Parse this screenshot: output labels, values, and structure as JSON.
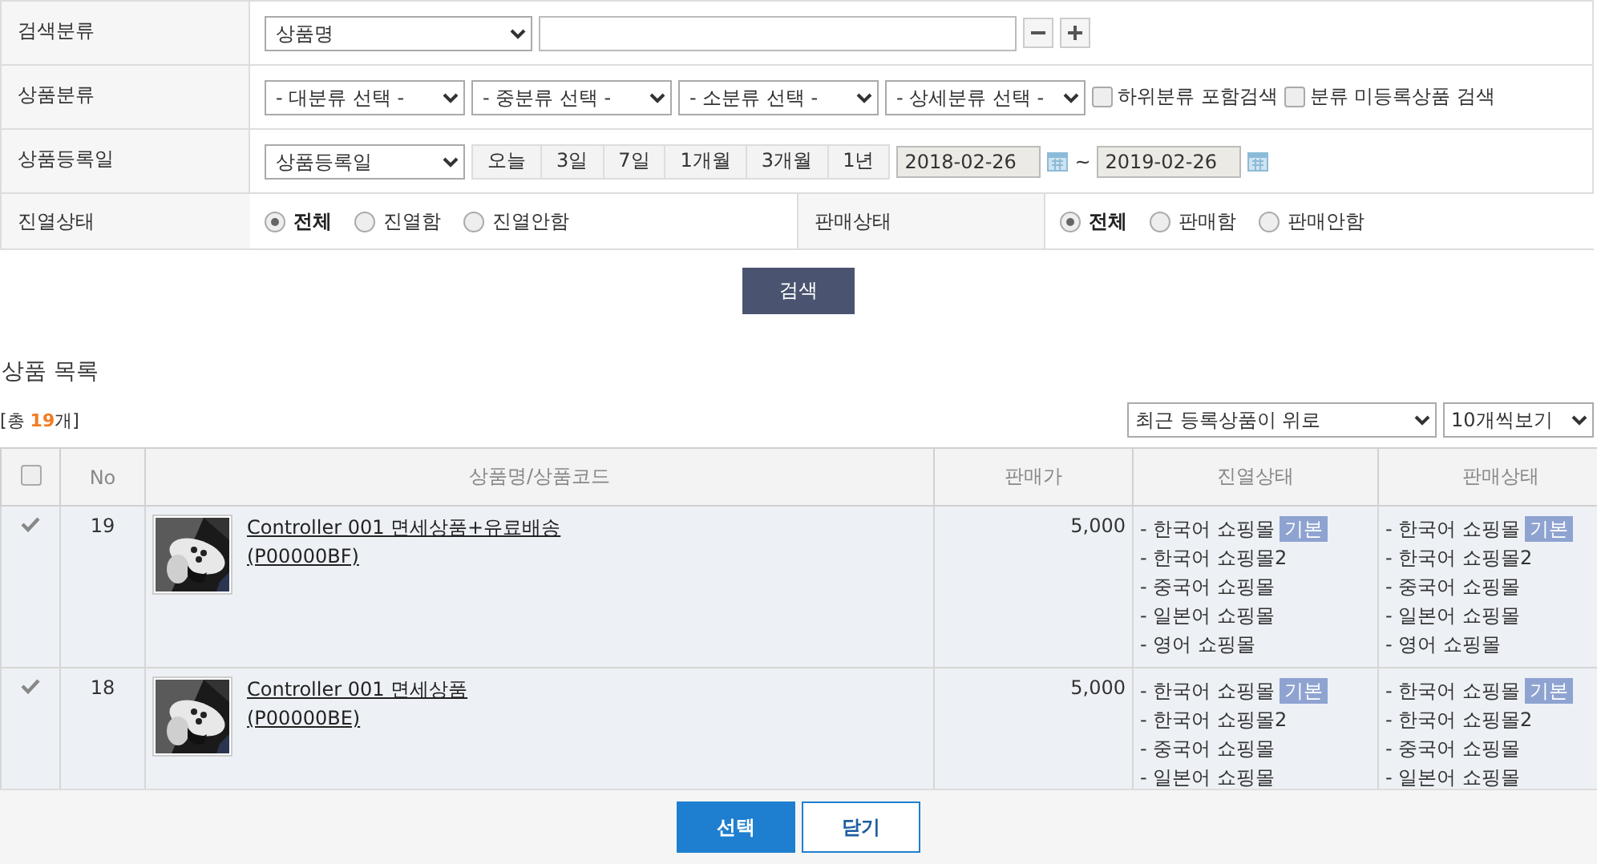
{
  "search_form": {
    "rows": [
      {
        "kind": "keyword",
        "label": "검색분류",
        "select": "상품명"
      },
      {
        "kind": "category",
        "label": "상품분류",
        "selects": [
          "- 대분류 선택 -",
          "- 중분류 선택 -",
          "- 소분류 선택 -",
          "- 상세분류 선택 -"
        ],
        "checkboxes": [
          {
            "label": "하위분류 포함검색",
            "checked": false
          },
          {
            "label": "분류 미등록상품 검색",
            "checked": false
          }
        ]
      },
      {
        "kind": "date",
        "label": "상품등록일",
        "select": "상품등록일",
        "periods": [
          "오늘",
          "3일",
          "7일",
          "1개월",
          "3개월",
          "1년"
        ],
        "start": "2018-02-26",
        "separator": "~",
        "end": "2019-02-26"
      },
      {
        "kind": "status",
        "groups": [
          {
            "label": "진열상태",
            "options": [
              {
                "label": "전체",
                "selected": true
              },
              {
                "label": "진열함",
                "selected": false
              },
              {
                "label": "진열안함",
                "selected": false
              }
            ]
          },
          {
            "label": "판매상태",
            "options": [
              {
                "label": "전체",
                "selected": true
              },
              {
                "label": "판매함",
                "selected": false
              },
              {
                "label": "판매안함",
                "selected": false
              }
            ]
          }
        ]
      }
    ],
    "search_button": "검색"
  },
  "list": {
    "title": "상품 목록",
    "total": {
      "before": "[총 ",
      "count": "19",
      "after": "개]"
    },
    "sort": "최근 등록상품이 위로",
    "per_page": "10개씩보기",
    "select_all": {
      "checked": false
    },
    "columns": [
      "No",
      "상품명/상품코드",
      "판매가",
      "진열상태",
      "판매상태"
    ],
    "rows": [
      {
        "checked": true,
        "no": "19",
        "name": "Controller 001 면세상품+유료배송",
        "code": "(P00000BF)",
        "price": "5,000",
        "display": [
          {
            "text": "- 한국어 쇼핑몰",
            "badge": "기본"
          },
          {
            "text": "- 한국어 쇼핑몰2"
          },
          {
            "text": "- 중국어 쇼핑몰"
          },
          {
            "text": "- 일본어 쇼핑몰"
          },
          {
            "text": "- 영어 쇼핑몰"
          }
        ],
        "sale": [
          {
            "text": "- 한국어 쇼핑몰",
            "badge": "기본"
          },
          {
            "text": "- 한국어 쇼핑몰2"
          },
          {
            "text": "- 중국어 쇼핑몰"
          },
          {
            "text": "- 일본어 쇼핑몰"
          },
          {
            "text": "- 영어 쇼핑몰"
          }
        ]
      },
      {
        "checked": true,
        "no": "18",
        "name": "Controller 001 면세상품",
        "code": "(P00000BE)",
        "price": "5,000",
        "display": [
          {
            "text": "- 한국어 쇼핑몰",
            "badge": "기본"
          },
          {
            "text": "- 한국어 쇼핑몰2"
          },
          {
            "text": "- 중국어 쇼핑몰"
          },
          {
            "text": "- 일본어 쇼핑몰"
          }
        ],
        "sale": [
          {
            "text": "- 한국어 쇼핑몰",
            "badge": "기본"
          },
          {
            "text": "- 한국어 쇼핑몰2"
          },
          {
            "text": "- 중국어 쇼핑몰"
          },
          {
            "text": "- 일본어 쇼핑몰"
          }
        ]
      }
    ]
  },
  "footer": {
    "buttons": [
      {
        "label": "선택",
        "kind": "primary"
      },
      {
        "label": "닫기",
        "kind": "secondary"
      }
    ]
  }
}
